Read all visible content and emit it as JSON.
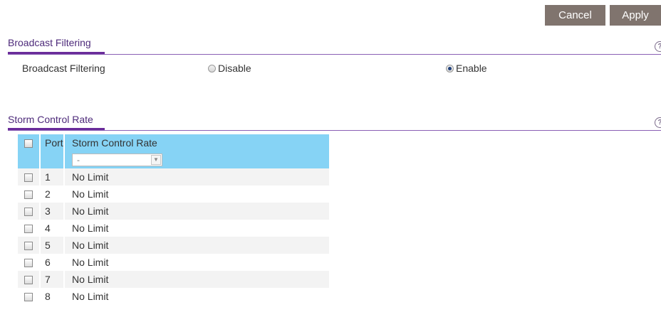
{
  "toolbar": {
    "cancel_label": "Cancel",
    "apply_label": "Apply"
  },
  "broadcast": {
    "section_title": "Broadcast Filtering",
    "field_label": "Broadcast Filtering",
    "options": [
      {
        "label": "Disable",
        "checked": false
      },
      {
        "label": "Enable",
        "checked": true
      }
    ]
  },
  "storm": {
    "section_title": "Storm Control Rate",
    "columns": {
      "port": "Port",
      "rate": "Storm Control Rate"
    },
    "filter_value": "-",
    "rows": [
      {
        "port": "1",
        "rate": "No Limit"
      },
      {
        "port": "2",
        "rate": "No Limit"
      },
      {
        "port": "3",
        "rate": "No Limit"
      },
      {
        "port": "4",
        "rate": "No Limit"
      },
      {
        "port": "5",
        "rate": "No Limit"
      },
      {
        "port": "6",
        "rate": "No Limit"
      },
      {
        "port": "7",
        "rate": "No Limit"
      },
      {
        "port": "8",
        "rate": "No Limit"
      }
    ]
  },
  "icons": {
    "help": "help-icon",
    "dropdown": "chevron-down-icon"
  },
  "colors": {
    "accent": "#6a2c9a",
    "header_bg": "#86d3f5",
    "button_bg": "#80746e"
  }
}
